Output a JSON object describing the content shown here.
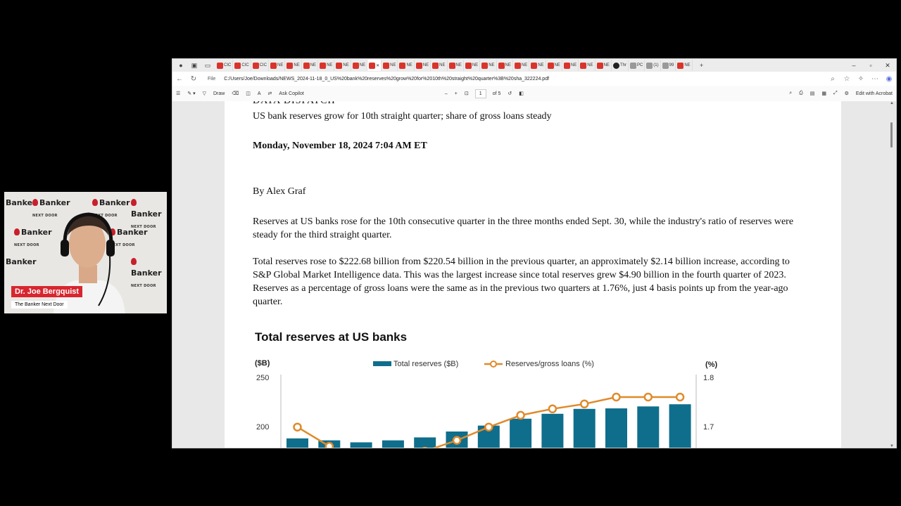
{
  "webcam": {
    "logo_line1": "Banker",
    "logo_line2": "NEXT DOOR",
    "presenter_name": "Dr. Joe Bergquist",
    "show_name": "The Banker Next Door"
  },
  "browser": {
    "tabs": [
      {
        "label": "CIC",
        "icon": "red"
      },
      {
        "label": "CIC",
        "icon": "red"
      },
      {
        "label": "CIC",
        "icon": "red"
      },
      {
        "label": "NE",
        "icon": "red"
      },
      {
        "label": "NE",
        "icon": "red"
      },
      {
        "label": "NE",
        "icon": "red"
      },
      {
        "label": "NE",
        "icon": "red"
      },
      {
        "label": "NE",
        "icon": "red"
      },
      {
        "label": "NE",
        "icon": "red"
      },
      {
        "label": "",
        "icon": "red",
        "active": true
      },
      {
        "label": "NE",
        "icon": "red"
      },
      {
        "label": "NE",
        "icon": "red"
      },
      {
        "label": "NE",
        "icon": "red"
      },
      {
        "label": "NE",
        "icon": "red"
      },
      {
        "label": "NE",
        "icon": "red"
      },
      {
        "label": "NE",
        "icon": "red"
      },
      {
        "label": "NE",
        "icon": "red"
      },
      {
        "label": "NE",
        "icon": "red"
      },
      {
        "label": "NE",
        "icon": "red"
      },
      {
        "label": "NE",
        "icon": "red"
      },
      {
        "label": "NE",
        "icon": "red"
      },
      {
        "label": "NE",
        "icon": "red"
      },
      {
        "label": "NE",
        "icon": "red"
      },
      {
        "label": "NE",
        "icon": "red"
      },
      {
        "label": "Thr",
        "icon": "dark"
      },
      {
        "label": "PC",
        "icon": "grey"
      },
      {
        "label": "(1)",
        "icon": "grey"
      },
      {
        "label": "99",
        "icon": "grey"
      },
      {
        "label": "NE",
        "icon": "red"
      }
    ],
    "address": {
      "scheme_label": "File",
      "url": "C:/Users/Joe/Downloads/NEWS_2024-11-18_0_US%20bank%20reserves%20grow%20for%2010th%20straight%20quarter%3B%20sha_322224.pdf"
    },
    "pdf_toolbar": {
      "draw_label": "Draw",
      "copilot_label": "Ask Copilot",
      "page_current": "1",
      "page_total": "of 5",
      "acrobat_label": "Edit with Acrobat"
    }
  },
  "document": {
    "dispatch_label": "DATA DISPATCH",
    "headline": "US bank reserves grow for 10th straight quarter; share of gross loans steady",
    "date": "Monday, November 18, 2024 7:04 AM ET",
    "author": "By Alex Graf",
    "paragraph1": "Reserves at US banks rose for the 10th consecutive quarter in the three months ended Sept. 30, while the industry's ratio of reserves were steady for the third straight quarter.",
    "paragraph2": "Total reserves rose to $222.68 billion from $220.54 billion in the previous quarter, an approximately $2.14 billion increase, according to S&P Global Market Intelligence data. This was the largest increase since total reserves grew $4.90 billion in the fourth quarter of 2023. Reserves as a percentage of gross loans were the same as in the previous two quarters at 1.76%, just 4 basis points up from the year-ago quarter."
  },
  "chart_data": {
    "type": "bar",
    "title": "Total reserves at US banks",
    "y_left_label": "($B)",
    "y_right_label": "(%)",
    "y_left_ticks": [
      "250",
      "200"
    ],
    "y_right_ticks": [
      "1.8",
      "1.7"
    ],
    "y_left_range": [
      150,
      250
    ],
    "y_right_range": [
      1.6,
      1.8
    ],
    "series": [
      {
        "name": "Total reserves ($B)",
        "kind": "bar",
        "color": "#0f6e8c",
        "values": [
          188,
          186,
          184,
          186,
          189,
          195,
          201,
          208,
          213,
          218,
          218.5,
          220.5,
          222.7
        ]
      },
      {
        "name": "Reserves/gross loans (%)",
        "kind": "line",
        "color": "#e08a2a",
        "values": [
          1.699,
          1.66,
          null,
          null,
          null,
          null,
          1.65,
          1.672,
          1.699,
          1.723,
          1.736,
          1.746,
          1.76,
          1.76,
          1.76
        ]
      }
    ],
    "legend_position": "top"
  },
  "colors": {
    "accent_red": "#d7262f",
    "bar": "#0f6e8c",
    "line": "#e08a2a"
  }
}
